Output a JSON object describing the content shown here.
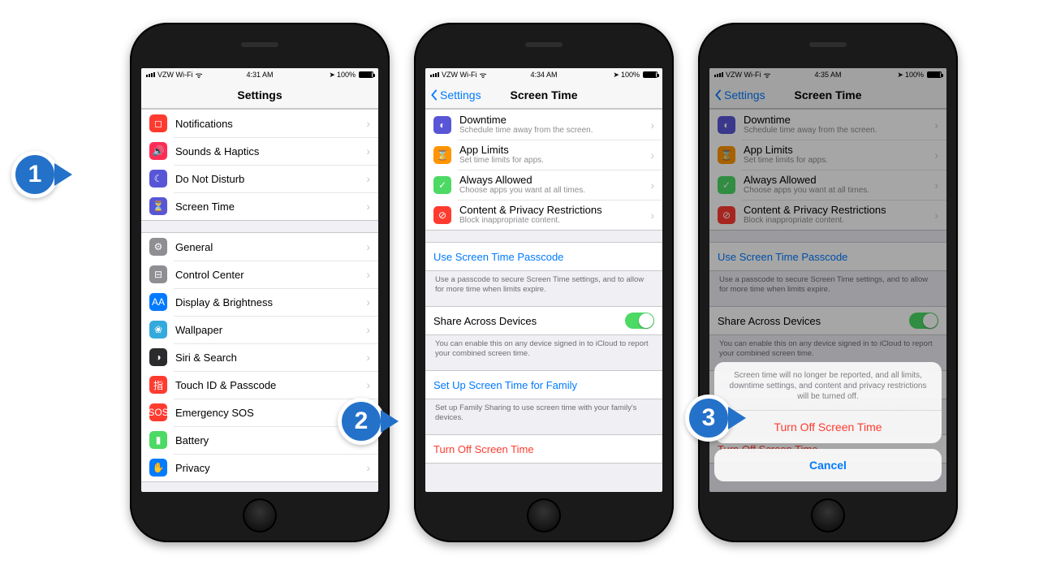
{
  "steps": [
    "1",
    "2",
    "3"
  ],
  "status": {
    "carrier": "VZW Wi-Fi",
    "times": [
      "4:31 AM",
      "4:34 AM",
      "4:35 AM"
    ],
    "battery": "100%"
  },
  "phone1": {
    "title": "Settings",
    "groups": [
      [
        {
          "icon": "#ff3b30",
          "glyph": "◻︎",
          "label": "Notifications"
        },
        {
          "icon": "#ff2d55",
          "glyph": "🔊",
          "label": "Sounds & Haptics"
        },
        {
          "icon": "#5856d6",
          "glyph": "☾",
          "label": "Do Not Disturb"
        },
        {
          "icon": "#5856d6",
          "glyph": "⏳",
          "label": "Screen Time"
        }
      ],
      [
        {
          "icon": "#8e8e93",
          "glyph": "⚙︎",
          "label": "General"
        },
        {
          "icon": "#8e8e93",
          "glyph": "⊟",
          "label": "Control Center"
        },
        {
          "icon": "#007aff",
          "glyph": "AA",
          "label": "Display & Brightness"
        },
        {
          "icon": "#34aadc",
          "glyph": "❀",
          "label": "Wallpaper"
        },
        {
          "icon": "#2b2b2e",
          "glyph": "◑",
          "label": "Siri & Search"
        },
        {
          "icon": "#ff3b30",
          "glyph": "指",
          "label": "Touch ID & Passcode"
        },
        {
          "icon": "#ff3b30",
          "glyph": "SOS",
          "label": "Emergency SOS"
        },
        {
          "icon": "#4cd964",
          "glyph": "▮",
          "label": "Battery"
        },
        {
          "icon": "#007aff",
          "glyph": "✋",
          "label": "Privacy"
        }
      ]
    ]
  },
  "screenTime": {
    "back": "Settings",
    "title": "Screen Time",
    "items": [
      {
        "icon": "#5856d6",
        "glyph": "◐",
        "label": "Downtime",
        "sub": "Schedule time away from the screen."
      },
      {
        "icon": "#ff9500",
        "glyph": "⌛",
        "label": "App Limits",
        "sub": "Set time limits for apps."
      },
      {
        "icon": "#4cd964",
        "glyph": "✓",
        "label": "Always Allowed",
        "sub": "Choose apps you want at all times."
      },
      {
        "icon": "#ff3b30",
        "glyph": "⊘",
        "label": "Content & Privacy Restrictions",
        "sub": "Block inappropriate content."
      }
    ],
    "passcode": "Use Screen Time Passcode",
    "passcodeFooter": "Use a passcode to secure Screen Time settings, and to allow for more time when limits expire.",
    "share": "Share Across Devices",
    "shareFooter": "You can enable this on any device signed in to iCloud to report your combined screen time.",
    "family": "Set Up Screen Time for Family",
    "familyFooter": "Set up Family Sharing to use screen time with your family's devices.",
    "turnOff": "Turn Off Screen Time"
  },
  "sheet": {
    "message": "Screen time will no longer be reported, and all limits, downtime settings, and content and privacy restrictions will be turned off.",
    "destructive": "Turn Off Screen Time",
    "cancel": "Cancel"
  }
}
